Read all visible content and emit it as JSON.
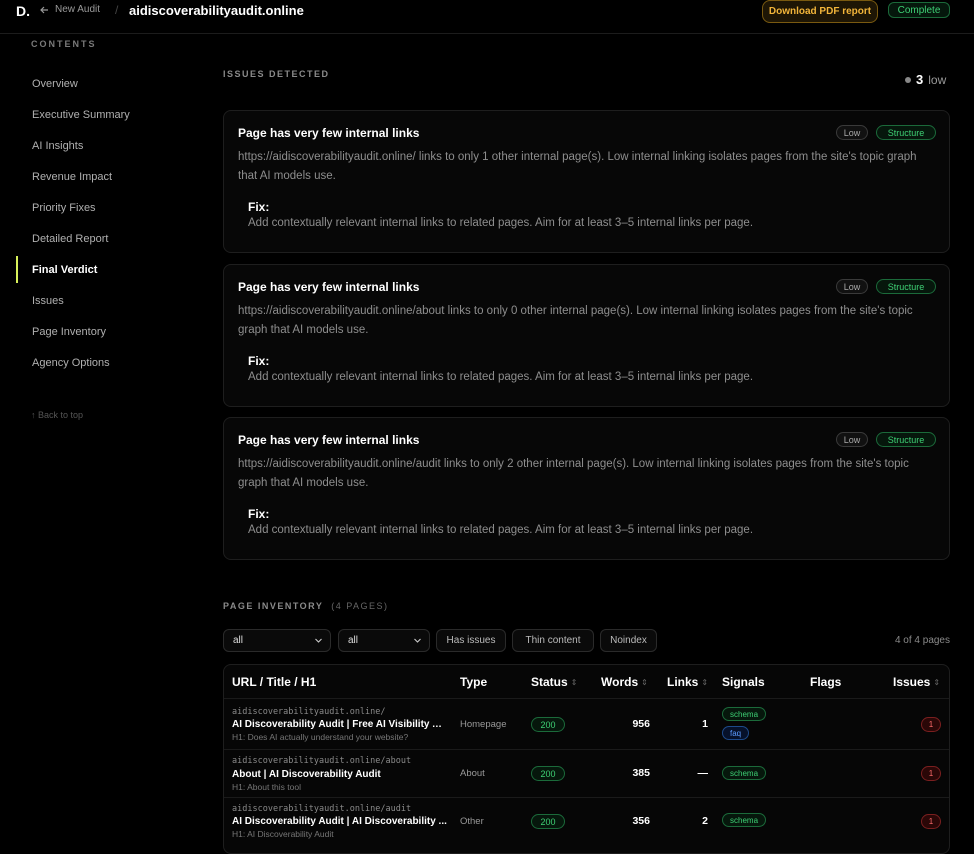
{
  "topbar": {
    "logo": "D.",
    "back_label": "New Audit",
    "separator": "/",
    "domain": "aidiscoverabilityaudit.online",
    "download_label": "Download PDF report",
    "status_badge": "Complete"
  },
  "sidebar": {
    "heading": "CONTENTS",
    "items": [
      {
        "label": "Overview"
      },
      {
        "label": "Executive Summary"
      },
      {
        "label": "AI Insights"
      },
      {
        "label": "Revenue Impact"
      },
      {
        "label": "Priority Fixes"
      },
      {
        "label": "Detailed Report"
      },
      {
        "label": "Final Verdict"
      },
      {
        "label": "Issues"
      },
      {
        "label": "Page Inventory"
      },
      {
        "label": "Agency Options"
      }
    ],
    "active_item": "Final Verdict",
    "back_to_top": "↑ Back to top"
  },
  "issues": {
    "heading": "ISSUES DETECTED",
    "count": "3",
    "count_label": "low",
    "cards": [
      {
        "title": "Page has very few internal links",
        "severity": "Low",
        "category": "Structure",
        "description": "https://aidiscoverabilityaudit.online/ links to only 1 other internal page(s). Low internal linking isolates pages from the site's topic graph that AI models use.",
        "fix_label": "Fix:",
        "fix": "Add contextually relevant internal links to related pages. Aim for at least 3–5 internal links per page."
      },
      {
        "title": "Page has very few internal links",
        "severity": "Low",
        "category": "Structure",
        "description": "https://aidiscoverabilityaudit.online/about links to only 0 other internal page(s). Low internal linking isolates pages from the site's topic graph that AI models use.",
        "fix_label": "Fix:",
        "fix": "Add contextually relevant internal links to related pages. Aim for at least 3–5 internal links per page."
      },
      {
        "title": "Page has very few internal links",
        "severity": "Low",
        "category": "Structure",
        "description": "https://aidiscoverabilityaudit.online/audit links to only 2 other internal page(s). Low internal linking isolates pages from the site's topic graph that AI models use.",
        "fix_label": "Fix:",
        "fix": "Add contextually relevant internal links to related pages. Aim for at least 3–5 internal links per page."
      }
    ]
  },
  "inventory": {
    "heading": "PAGE INVENTORY",
    "subheading": "(4 PAGES)",
    "filter1": "all",
    "filter2": "all",
    "buttons": [
      "Has issues",
      "Thin content",
      "Noindex"
    ],
    "page_count": "4 of 4 pages",
    "columns": {
      "url": "URL / Title / H1",
      "type": "Type",
      "status": "Status",
      "words": "Words",
      "links": "Links",
      "signals": "Signals",
      "flags": "Flags",
      "issues": "Issues"
    },
    "sort_glyph": "⇕",
    "rows": [
      {
        "url": "aidiscoverabilityaudit.online/",
        "title": "AI Discoverability Audit | Free AI Visibility A...",
        "h1": "H1: Does AI actually understand your website?",
        "type": "Homepage",
        "status": "200",
        "words": "956",
        "links": "1",
        "signals": [
          "schema",
          "faq"
        ],
        "issues": "1"
      },
      {
        "url": "aidiscoverabilityaudit.online/about",
        "title": "About | AI Discoverability Audit",
        "h1": "H1: About this tool",
        "type": "About",
        "status": "200",
        "words": "385",
        "links": "—",
        "signals": [
          "schema"
        ],
        "issues": "1"
      },
      {
        "url": "aidiscoverabilityaudit.online/audit",
        "title": "AI Discoverability Audit | AI Discoverability ...",
        "h1": "H1: AI Discoverability Audit",
        "type": "Other",
        "status": "200",
        "words": "356",
        "links": "2",
        "signals": [
          "schema"
        ],
        "issues": "1"
      }
    ]
  }
}
